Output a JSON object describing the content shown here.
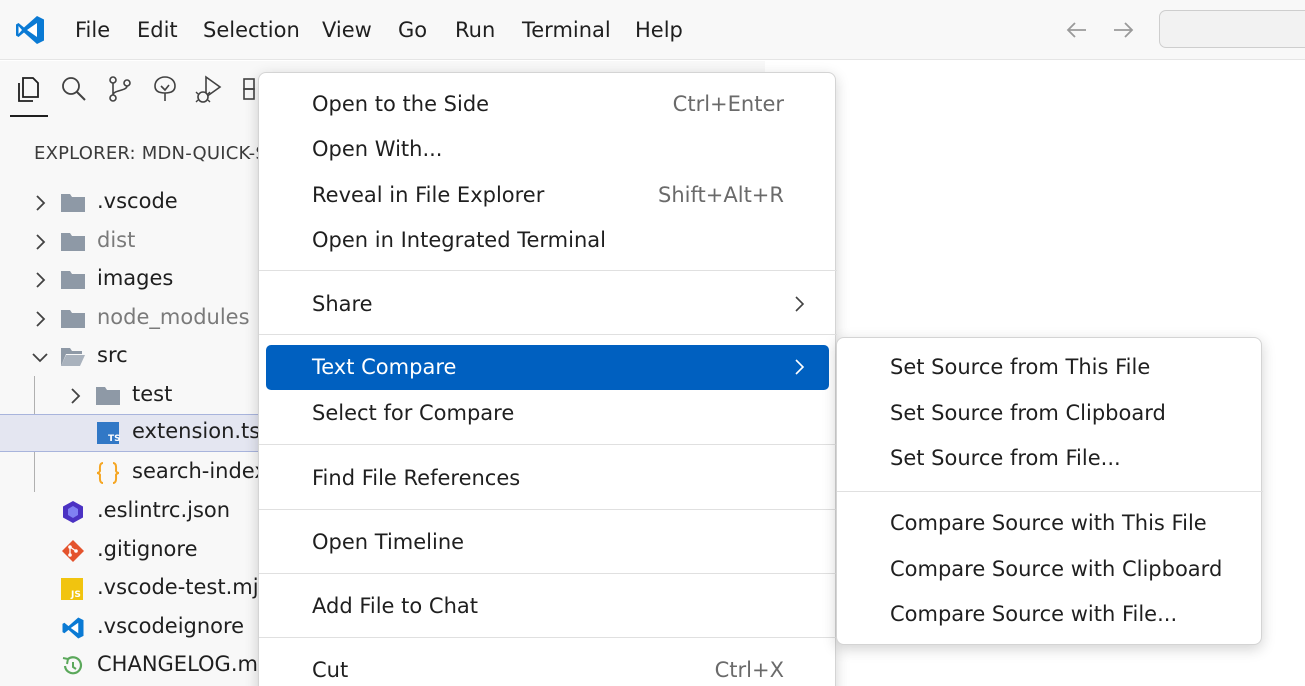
{
  "menubar": {
    "items": [
      "File",
      "Edit",
      "Selection",
      "View",
      "Go",
      "Run",
      "Terminal",
      "Help"
    ]
  },
  "activity_bar": {
    "icons": [
      "explorer-icon",
      "search-icon",
      "source-control-icon",
      "tree-icon",
      "run-debug-icon",
      "extensions-icon"
    ]
  },
  "explorer": {
    "title": "EXPLORER: MDN-QUICK-S",
    "items": [
      {
        "label": ".vscode",
        "type": "folder",
        "expanded": false
      },
      {
        "label": "dist",
        "type": "folder",
        "expanded": false,
        "dimmed": true
      },
      {
        "label": "images",
        "type": "folder",
        "expanded": false
      },
      {
        "label": "node_modules",
        "type": "folder",
        "expanded": false,
        "dimmed": true
      },
      {
        "label": "src",
        "type": "folder",
        "expanded": true
      },
      {
        "label": "test",
        "type": "folder",
        "expanded": false
      },
      {
        "label": "extension.ts",
        "type": "file",
        "icon": "typescript-icon",
        "selected": true
      },
      {
        "label": "search-index",
        "type": "file",
        "icon": "json-braces-icon"
      },
      {
        "label": ".eslintrc.json",
        "type": "file",
        "icon": "eslint-icon"
      },
      {
        "label": ".gitignore",
        "type": "file",
        "icon": "git-icon"
      },
      {
        "label": ".vscode-test.mjs",
        "type": "file",
        "icon": "js-icon"
      },
      {
        "label": ".vscodeignore",
        "type": "file",
        "icon": "vscode-icon"
      },
      {
        "label": "CHANGELOG.mc",
        "type": "file",
        "icon": "changelog-icon"
      }
    ]
  },
  "context_menu": {
    "items": [
      {
        "label": "Open to the Side",
        "shortcut": "Ctrl+Enter"
      },
      {
        "label": "Open With...",
        "shortcut": ""
      },
      {
        "label": "Reveal in File Explorer",
        "shortcut": "Shift+Alt+R"
      },
      {
        "label": "Open in Integrated Terminal",
        "shortcut": ""
      },
      {
        "label": "Share",
        "shortcut": "",
        "submenu": true
      },
      {
        "label": "Text Compare",
        "shortcut": "",
        "submenu": true,
        "active": true
      },
      {
        "label": "Select for Compare",
        "shortcut": ""
      },
      {
        "label": "Find File References",
        "shortcut": ""
      },
      {
        "label": "Open Timeline",
        "shortcut": ""
      },
      {
        "label": "Add File to Chat",
        "shortcut": ""
      },
      {
        "label": "Cut",
        "shortcut": "Ctrl+X"
      }
    ]
  },
  "submenu": {
    "items": [
      "Set Source from This File",
      "Set Source from Clipboard",
      "Set Source from File...",
      "Compare Source with This File",
      "Compare Source with Clipboard",
      "Compare Source with File..."
    ]
  },
  "colors": {
    "accent": "#0060c0",
    "selection": "#e4e6f1",
    "folder": "#8e99a6",
    "typescript": "#3178c6",
    "json": "#f5a623",
    "eslint": "#4b32c3",
    "git": "#e4532d",
    "js": "#f1c40f",
    "vscode": "#0a7ad4",
    "changelog": "#5ba85b"
  }
}
